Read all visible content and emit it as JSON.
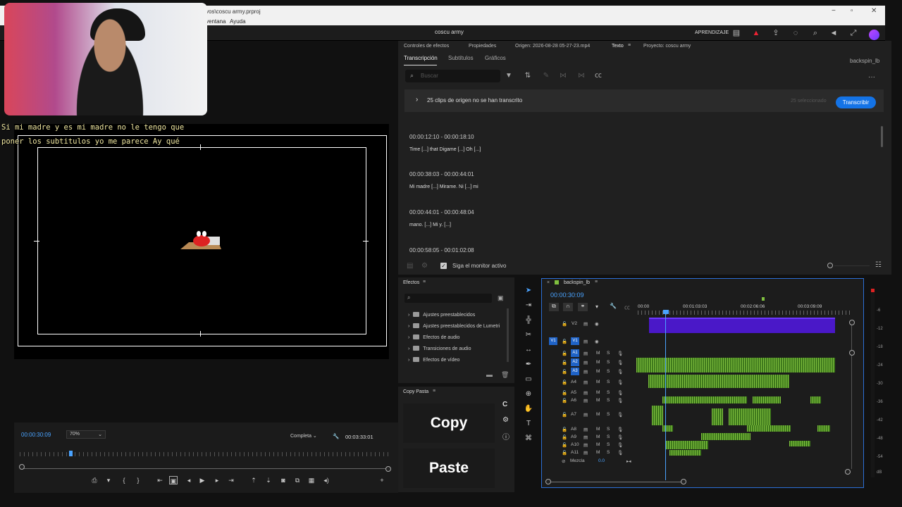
{
  "window": {
    "title": "vos\\coscu army.prproj",
    "menu": [
      "ventana",
      "Ayuda"
    ]
  },
  "header": {
    "project": "coscu army",
    "learn": "APRENDIZAJE"
  },
  "caption": {
    "line1": "Si mi madre y es mi madre no le tengo que",
    "line2": "poner los subtitulos yo me parece Ay qué"
  },
  "monitor": {
    "timecode": "00:00:30:09",
    "zoom": "70%",
    "quality": "Completa",
    "duration": "00:03:33:01"
  },
  "text_panel": {
    "tabs": [
      "Controles de efectos",
      "Propiedades",
      "Origen: 2026-08-28 05-27-23.mp4",
      "Texto",
      "Proyecto: coscu army"
    ],
    "subtabs": [
      "Transcripción",
      "Subtítulos",
      "Gráficos"
    ],
    "sequence": "backspin_lb",
    "search_placeholder": "Buscar",
    "notice": "25 clips de origen no se han transcrito",
    "selected": "25 seleccionado",
    "transcribe_button": "Transcribir",
    "segments": [
      {
        "time": "00:00:12:10 - 00:00:18:10",
        "text": "Time [...] that Digame [...] Oh [...]"
      },
      {
        "time": "00:00:38:03 - 00:00:44:01",
        "text": "Mi madre [...] Mirame. Ni [...] mi"
      },
      {
        "time": "00:00:44:01 - 00:00:48:04",
        "text": "mano. [...] Mi y. [...]"
      },
      {
        "time": "00:00:58:05 - 00:01:02:08",
        "text": ""
      }
    ],
    "follow_monitor": "Siga el monitor activo"
  },
  "effects": {
    "title": "Efectos",
    "items": [
      "Ajustes preestablecidos",
      "Ajustes preestablecidos de Lumetri",
      "Efectos de audio",
      "Transiciones de audio",
      "Efectos de vídeo"
    ]
  },
  "copy_paste": {
    "title": "Copy Pasta",
    "copy": "Copy",
    "paste": "Paste",
    "c_label": "C"
  },
  "timeline": {
    "sequence": "backspin_lb",
    "timecode": "00:00:30:09",
    "ruler": [
      "00:00",
      "00:01:03:03",
      "00:02:06:06",
      "00:03:09:09"
    ],
    "video_tracks": [
      "V2",
      "V1"
    ],
    "audio_tracks": [
      "A1",
      "A2",
      "A3",
      "A4",
      "A5",
      "A6",
      "A7",
      "A8",
      "A9",
      "A10",
      "A11"
    ],
    "mix_label": "Mezcla",
    "mix_value": "0.0"
  },
  "meter": {
    "labels": [
      "-6",
      "-12",
      "-18",
      "-24",
      "-30",
      "-36",
      "-42",
      "-48",
      "-54",
      "dB"
    ]
  }
}
